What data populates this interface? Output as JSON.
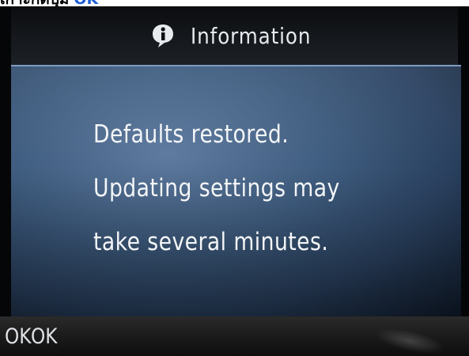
{
  "page_caption": {
    "text": "เกาะกดปุม",
    "accent": "OK",
    "accent_color": "#1f5fd6"
  },
  "dialog": {
    "title": "Information",
    "icon": "info-icon",
    "messages": [
      "Defaults restored.",
      "Updating settings may",
      "take several minutes."
    ]
  },
  "footer": {
    "button_tag": "OK",
    "button_label": "OK"
  },
  "colors": {
    "panel_blue": "#3f5d80",
    "text": "#f3f5f7",
    "frame": "#050608"
  }
}
